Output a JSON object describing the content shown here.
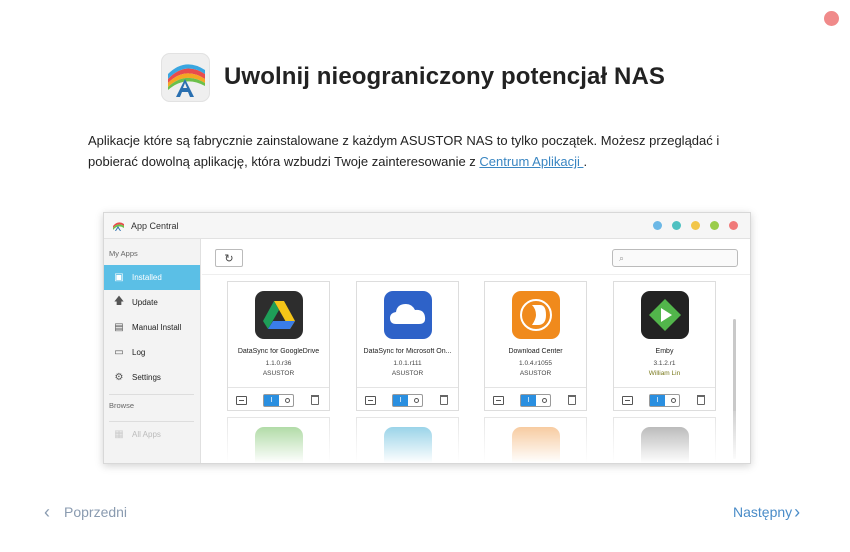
{
  "dialog": {
    "title": "Uwolnij nieograniczony potencjał NAS",
    "description_before_link": "Aplikacje które są fabrycznie zainstalowane z każdym ASUSTOR NAS to tylko początek. Możesz przeglądać i pobierać dowolną aplikację, która wzbudzi Twoje zainteresowanie z ",
    "link_text": "Centrum Aplikacji ",
    "description_after_link": ".",
    "prev_label": "Poprzedni",
    "next_label": "Następny",
    "close_color": "#f08a8a"
  },
  "app_window": {
    "title": "App Central",
    "window_dots": [
      "#6cb8e6",
      "#4fc1c1",
      "#f2c649",
      "#9acd4a",
      "#f07a7a"
    ],
    "sidebar": {
      "section1": "My Apps",
      "items": [
        {
          "label": "Installed",
          "icon": "installed-icon",
          "active": true
        },
        {
          "label": "Update",
          "icon": "update-arrow-icon"
        },
        {
          "label": "Manual Install",
          "icon": "manual-install-icon"
        },
        {
          "label": "Log",
          "icon": "log-icon"
        },
        {
          "label": "Settings",
          "icon": "gear-icon"
        }
      ],
      "section2": "Browse",
      "browse_item": "All Apps"
    },
    "apps": [
      {
        "name": "DataSync for GoogleDrive",
        "version": "1.1.0.r36",
        "publisher": "ASUSTOR",
        "icon": "google-drive-icon",
        "color": "#2d2d2d"
      },
      {
        "name": "DataSync for Microsoft On...",
        "version": "1.0.1.r111",
        "publisher": "ASUSTOR",
        "icon": "onedrive-cloud-icon",
        "color": "#2e62c8"
      },
      {
        "name": "Download Center",
        "version": "1.0.4.r1055",
        "publisher": "ASUSTOR",
        "icon": "download-center-icon",
        "color": "#f08a1c"
      },
      {
        "name": "Emby",
        "version": "3.1.2.r1",
        "publisher": "William Lin",
        "icon": "emby-icon",
        "color": "#222222"
      }
    ],
    "second_row_colors": [
      "#7cc36b",
      "#55b6d9",
      "#f2a860",
      "#8d8d8d"
    ]
  }
}
